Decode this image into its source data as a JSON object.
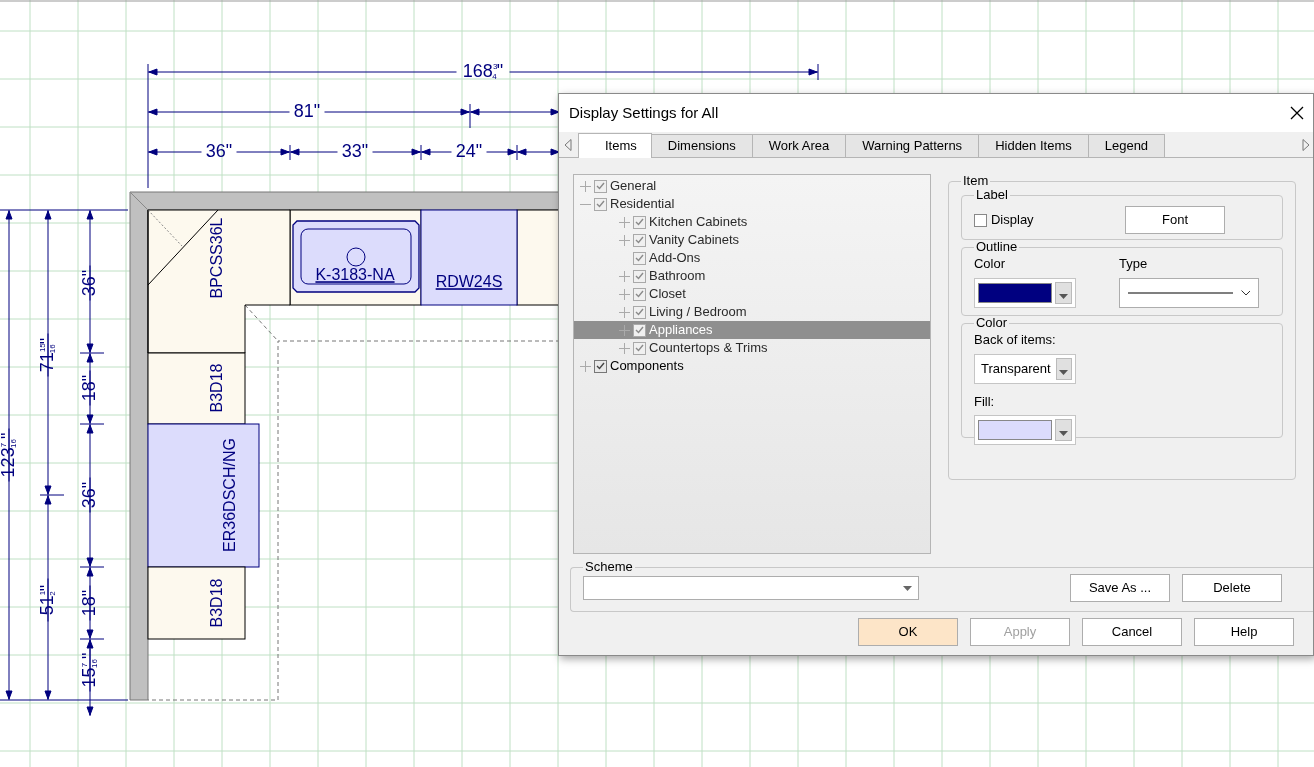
{
  "drawing": {
    "cabinets": [
      {
        "label": "BPCSS36L",
        "kind": "corner",
        "color": "#fdf9ee"
      },
      {
        "label": "K-3183-NA",
        "kind": "sink",
        "color": "#dcdcfc"
      },
      {
        "label": "RDW24S",
        "kind": "box",
        "color": "#dcdcfc"
      },
      {
        "label": "B3D18",
        "kind": "box",
        "color": "#fdf9ee"
      },
      {
        "label": "ER36DSCH/NG",
        "kind": "box",
        "color": "#dcdcfc"
      },
      {
        "label": "B3D18",
        "kind": "box",
        "color": "#fdf9ee"
      }
    ],
    "dimensions_top": [
      {
        "whole": "168",
        "num": "3",
        "den": "4",
        "unit": "\""
      },
      {
        "whole": "81",
        "unit": "\""
      },
      {
        "whole": "36",
        "unit": "\""
      },
      {
        "whole": "33",
        "unit": "\""
      },
      {
        "whole": "24",
        "unit": "\""
      }
    ],
    "dimensions_left": [
      {
        "whole": "123",
        "num": "7",
        "den": "16",
        "unit": "\""
      },
      {
        "whole": "71",
        "num": "15",
        "den": "16",
        "unit": "\""
      },
      {
        "whole": "51",
        "num": "1",
        "den": "2",
        "unit": "\""
      },
      {
        "whole": "36",
        "unit": "\""
      },
      {
        "whole": "18",
        "unit": "\""
      },
      {
        "whole": "36",
        "unit": "\""
      },
      {
        "whole": "18",
        "unit": "\""
      },
      {
        "whole": "15",
        "num": "7",
        "den": "16",
        "unit": "\""
      }
    ]
  },
  "window": {
    "title": "Display Settings for All"
  },
  "tabs": [
    {
      "label": "Items",
      "selected": true
    },
    {
      "label": "Dimensions",
      "selected": false
    },
    {
      "label": "Work Area",
      "selected": false
    },
    {
      "label": "Warning Patterns",
      "selected": false
    },
    {
      "label": "Hidden Items",
      "selected": false
    },
    {
      "label": "Legend",
      "selected": false
    }
  ],
  "tree": [
    {
      "label": "General",
      "checked": true,
      "disabled": true,
      "expanded": false,
      "selected": false
    },
    {
      "label": "Residential",
      "checked": true,
      "disabled": true,
      "expanded": true,
      "selected": false,
      "children": [
        {
          "label": "Kitchen Cabinets",
          "checked": true,
          "disabled": true,
          "expanded": false,
          "selected": false
        },
        {
          "label": "Vanity Cabinets",
          "checked": true,
          "disabled": true,
          "expanded": false,
          "selected": false
        },
        {
          "label": "Add-Ons",
          "checked": true,
          "disabled": true,
          "selected": false
        },
        {
          "label": "Bathroom",
          "checked": true,
          "disabled": true,
          "expanded": false,
          "selected": false
        },
        {
          "label": "Closet",
          "checked": true,
          "disabled": true,
          "expanded": false,
          "selected": false
        },
        {
          "label": "Living / Bedroom",
          "checked": true,
          "disabled": true,
          "expanded": false,
          "selected": false
        },
        {
          "label": "Appliances",
          "checked": true,
          "disabled": true,
          "expanded": false,
          "selected": true
        },
        {
          "label": "Countertops & Trims",
          "checked": true,
          "disabled": true,
          "expanded": false,
          "selected": false
        }
      ]
    },
    {
      "label": "Components",
      "checked": true,
      "disabled": false,
      "expanded": false,
      "selected": false
    }
  ],
  "item_group": {
    "title": "Item",
    "label_group": {
      "title": "Label",
      "display_label": "Display",
      "display_checked": false,
      "font_button": "Font"
    },
    "outline_group": {
      "title": "Outline",
      "color_label": "Color",
      "color": "#000080",
      "type_label": "Type"
    },
    "color_group": {
      "title": "Color",
      "back_label": "Back of items:",
      "back_value": "Transparent",
      "fill_label": "Fill:",
      "fill": {
        "color": "#dcdcfc"
      }
    }
  },
  "scheme": {
    "title": "Scheme",
    "buttons": [
      "Save As ...",
      "Delete"
    ]
  },
  "footer_buttons": [
    {
      "label": "OK",
      "default": true,
      "disabled": false
    },
    {
      "label": "Apply",
      "default": false,
      "disabled": true
    },
    {
      "label": "Cancel",
      "default": false,
      "disabled": false
    },
    {
      "label": "Help",
      "default": false,
      "disabled": false
    }
  ]
}
